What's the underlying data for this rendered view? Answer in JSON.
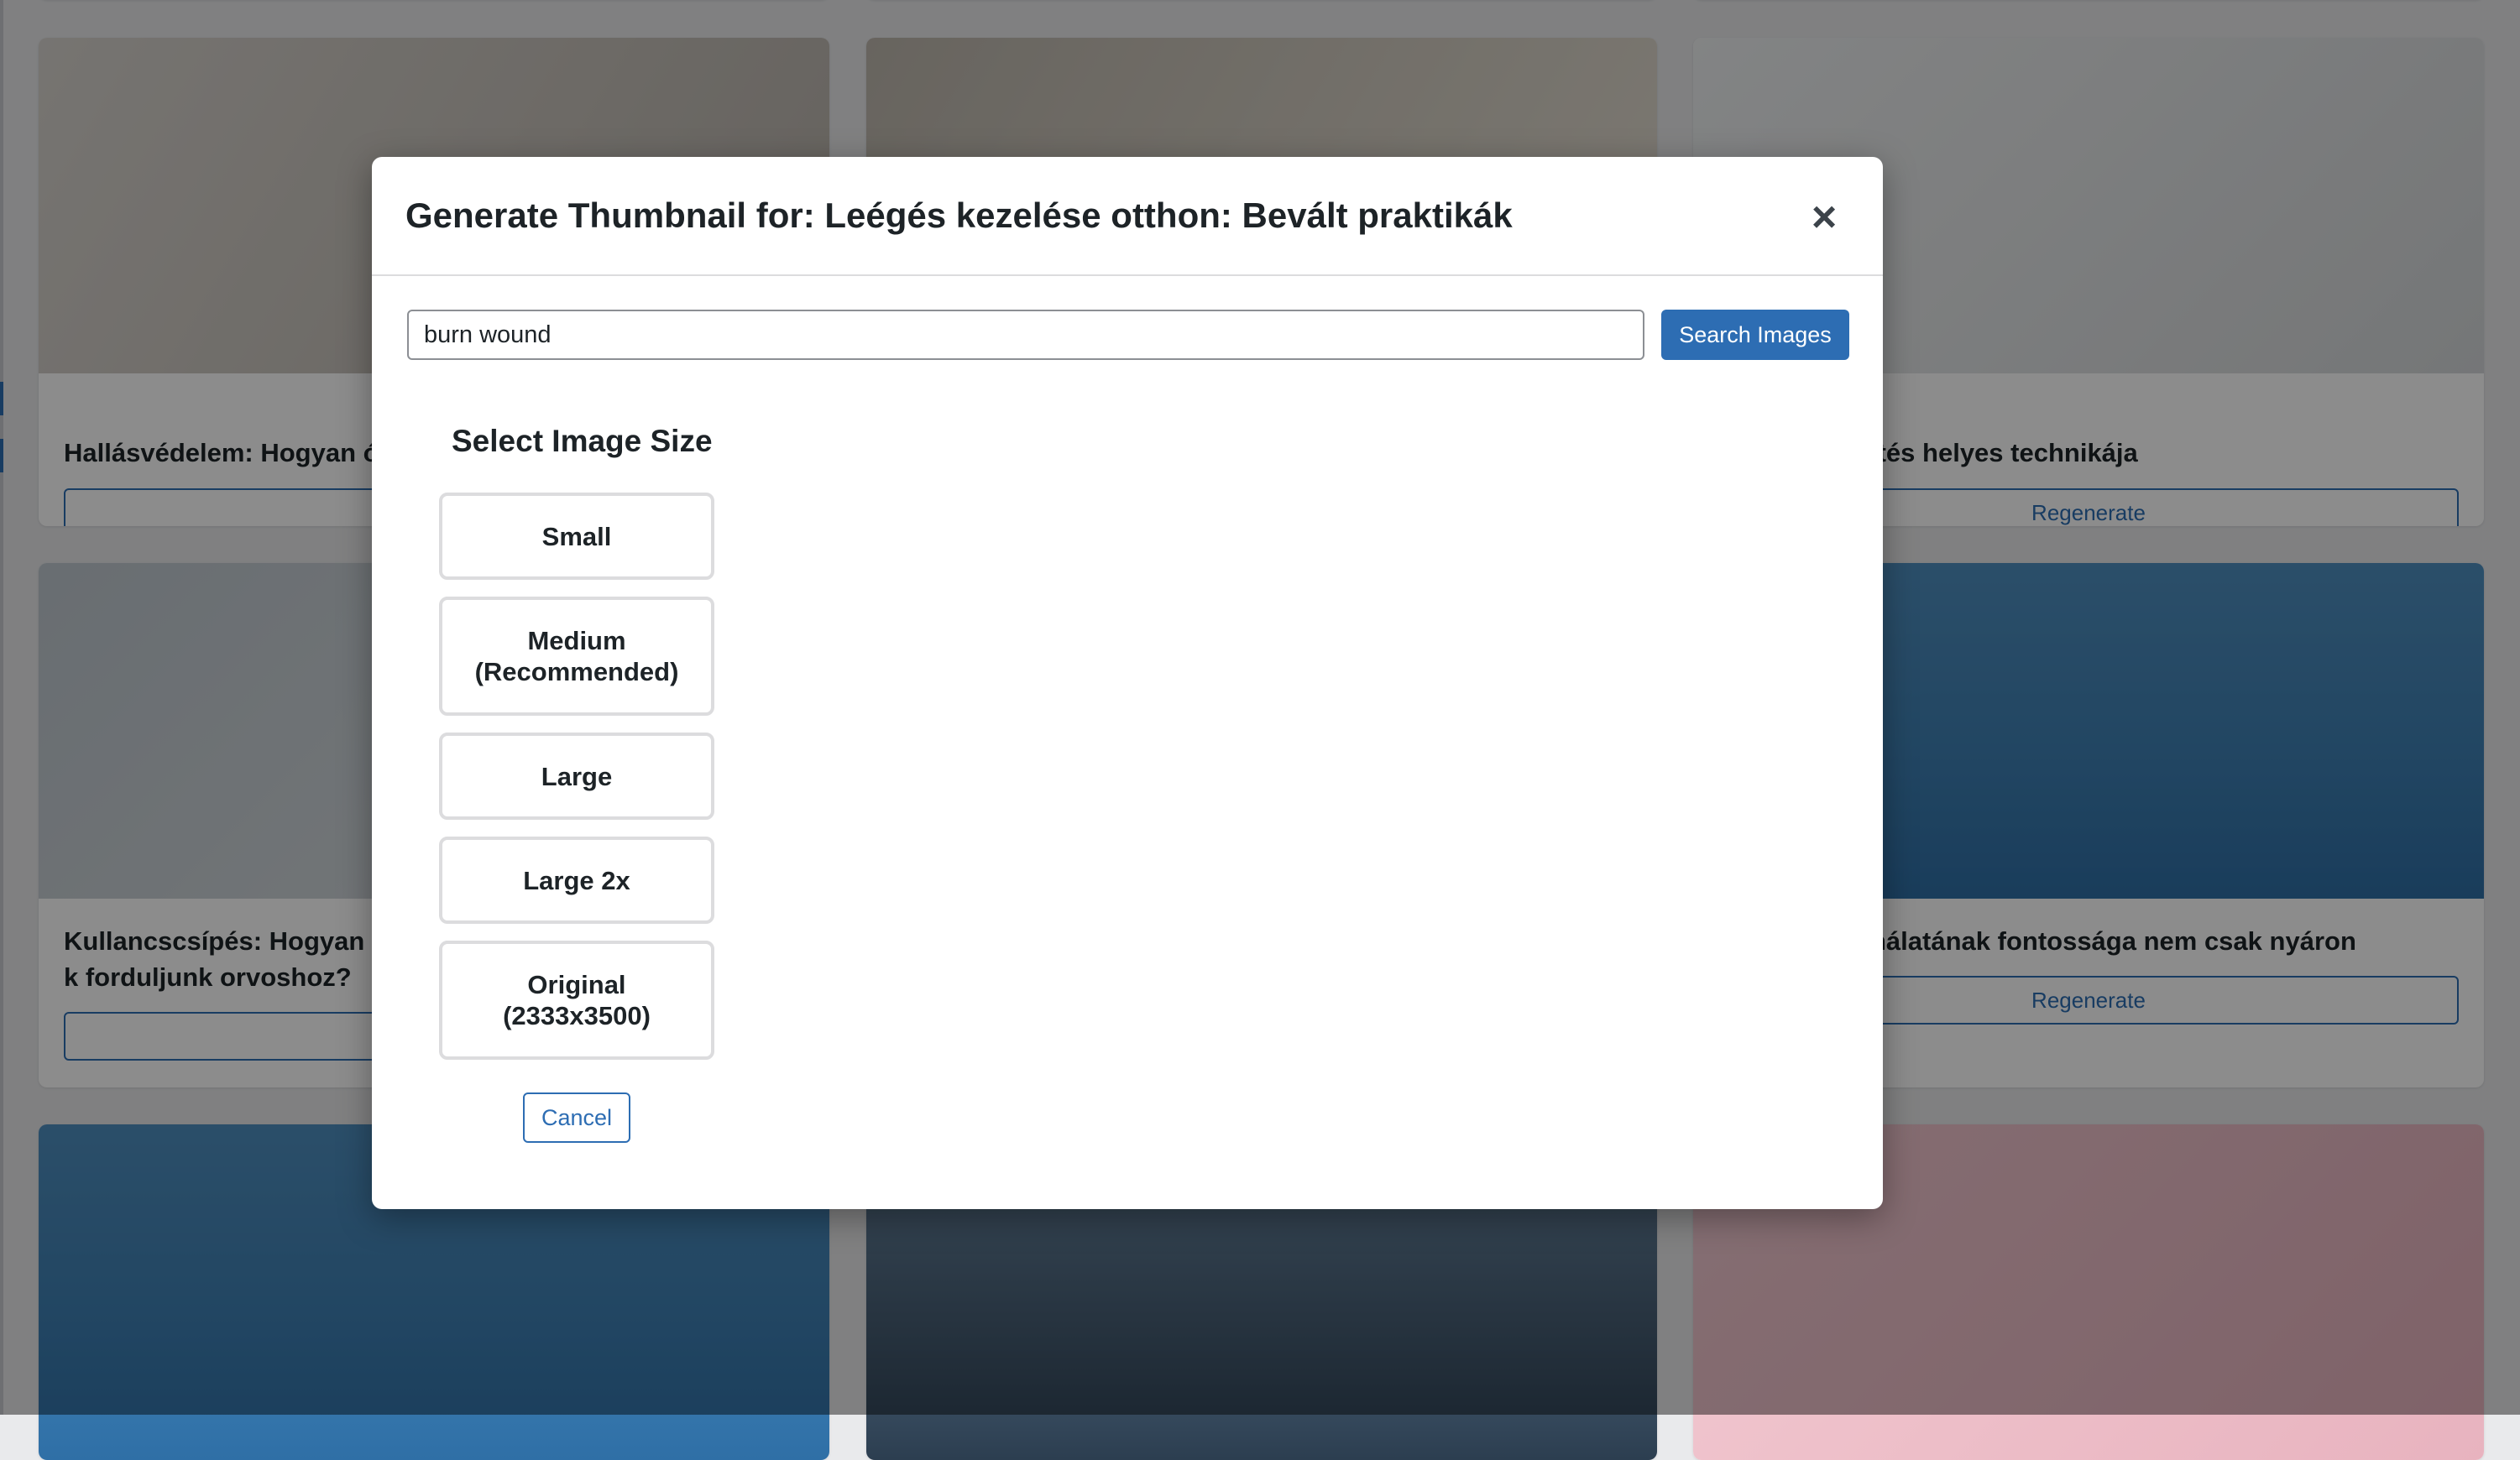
{
  "background": {
    "cards": [
      {
        "title": "Hallásvédelem: Hogyan óv",
        "button": ""
      },
      {
        "title": "",
        "button": ""
      },
      {
        "title": "ítés helyes technikája",
        "button": "Regenerate"
      },
      {
        "title": "Kullancscsípés: Hogyan k forduljunk orvoshoz?",
        "button": ""
      },
      {
        "title": "nálatának fontossága nem csak nyáron",
        "button": "Regenerate"
      }
    ]
  },
  "modal": {
    "title": "Generate Thumbnail for: Leégés kezelése otthon: Bevált praktikák",
    "close_icon": "close-icon",
    "search": {
      "value": "burn wound",
      "button_label": "Search Images"
    },
    "size_heading": "Select Image Size",
    "sizes": [
      {
        "label": "Small"
      },
      {
        "label": "Medium\n(Recommended)"
      },
      {
        "label": "Large"
      },
      {
        "label": "Large 2x"
      },
      {
        "label": "Original\n(2333x3500)"
      }
    ],
    "cancel_label": "Cancel"
  },
  "colors": {
    "accent": "#2d6db3",
    "overlay": "rgba(0,0,0,0.45)"
  }
}
